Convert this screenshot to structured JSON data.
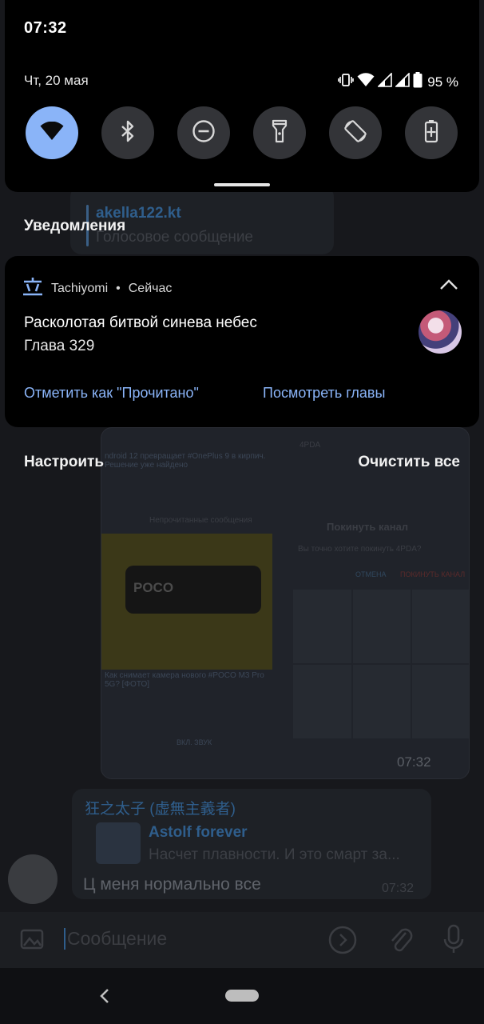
{
  "status_bar": {
    "time": "07:32",
    "date": "Чт, 20 мая",
    "battery_percent": "95 %"
  },
  "quick_settings": [
    {
      "name": "wifi",
      "icon": "wifi-icon",
      "state": "on"
    },
    {
      "name": "bluetooth",
      "icon": "bluetooth-icon",
      "state": "off"
    },
    {
      "name": "do-not-disturb",
      "icon": "dnd-icon",
      "state": "off"
    },
    {
      "name": "flashlight",
      "icon": "flashlight-icon",
      "state": "off"
    },
    {
      "name": "auto-rotate",
      "icon": "rotate-icon",
      "state": "off"
    },
    {
      "name": "battery-saver",
      "icon": "battery-saver-icon",
      "state": "off"
    }
  ],
  "notifications": {
    "header": "Уведомления",
    "items": [
      {
        "app_name": "Tachiyomi",
        "time": "Сейчас",
        "title": "Расколотая битвой синева небес",
        "text": "Глава 329",
        "actions": [
          "Отметить как \"Прочитано\"",
          "Посмотреть главы"
        ]
      }
    ],
    "manage_label": "Настроить",
    "clear_all_label": "Очистить все"
  },
  "background_chat": {
    "top_reply_author": "akella122.kt",
    "top_reply_text": "Голосовое сообщение",
    "screenshot_text_1": "ndroid 12 превращает #OnePlus 9 в кирпич. Решение уже найдено",
    "screenshot_unread": "Непрочитанные сообщения",
    "screenshot_text_2": "Как снимает камера нового #POCO M3 Pro 5G? [ФОТО]",
    "screenshot_sound": "ВКЛ. ЗВУК",
    "screenshot_dialog_title": "Покинуть канал",
    "screenshot_dialog_text": "Вы точно хотите покинуть 4PDA?",
    "screenshot_dialog_cancel": "ОТМЕНА",
    "screenshot_dialog_confirm": "ПОКИНУТЬ КАНАЛ",
    "screenshot_brand": "POCO",
    "screenshot_channel": "4PDA",
    "screenshot_time": "07:32",
    "message_author": "狂之太子 (虚無主義者)",
    "quoted_author": "Astolf forever",
    "quoted_text": "Насчет плавности. И это смарт за...",
    "message_text": "Ц меня нормально  все",
    "message_time": "07:32",
    "input_placeholder": "Сообщение"
  },
  "colors": {
    "accent": "#8ab4f8",
    "panel_bg": "#000000",
    "tile_off": "#333438"
  }
}
